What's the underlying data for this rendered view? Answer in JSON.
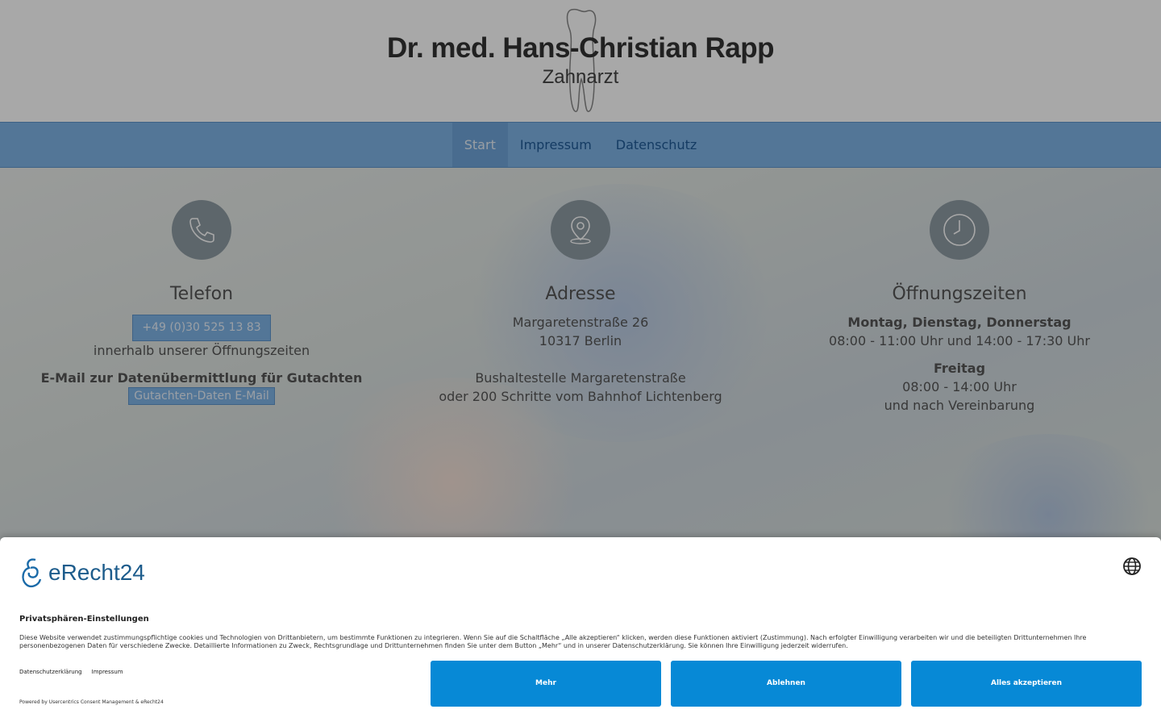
{
  "header": {
    "name": "Dr. med. Hans-Christian Rapp",
    "subtitle": "Zahnarzt"
  },
  "nav": {
    "items": [
      {
        "label": "Start",
        "active": true
      },
      {
        "label": "Impressum",
        "active": false
      },
      {
        "label": "Datenschutz",
        "active": false
      }
    ]
  },
  "contact": {
    "title": "Telefon",
    "phone": "+49 (0)30 525 13 83",
    "phone_note": "innerhalb unserer Öffnungszeiten",
    "email_heading": "E-Mail zur Datenübermittlung für Gutachten",
    "email_button": "Gutachten-Daten E-Mail",
    "icon": "phone-icon"
  },
  "address": {
    "title": "Adresse",
    "street": "Margaretenstraße 26",
    "city": "10317 Berlin",
    "transit1": "Bushaltestelle Margaretenstraße",
    "transit2": "oder 200 Schritte vom Bahnhof Lichtenberg",
    "icon": "location-pin-icon"
  },
  "hours": {
    "title": "Öffnungszeiten",
    "days1": "Montag, Dienstag, Donnerstag",
    "time1": "08:00 - 11:00 Uhr und 14:00 - 17:30 Uhr",
    "days2": "Freitag",
    "time2": "08:00 - 14:00 Uhr",
    "extra": "und nach Vereinbarung",
    "icon": "clock-icon"
  },
  "consent": {
    "brand": "eRecht24",
    "title": "Privatsphären-Einstellungen",
    "text": "Diese Website verwendet zustimmungspflichtige cookies und Technologien von Drittanbietern, um bestimmte Funktionen zu integrieren. Wenn Sie auf die Schaltfläche „Alle akzeptieren“ klicken, werden diese Funktionen aktiviert (Zustimmung). Nach erfolgter Einwilligung verarbeiten wir und die beteiligten Drittunternehmen Ihre personenbezogenen Daten für verschiedene Zwecke. Detaillierte Informationen zu Zweck, Rechtsgrundlage und Drittunternehmen finden Sie unter dem Button „Mehr“ und in unserer Datenschutzerklärung. Sie können Ihre Einwilligung jederzeit widerrufen.",
    "link_privacy": "Datenschutzerklärung",
    "link_imprint": "Impressum",
    "powered": "Powered by Usercentrics Consent Management & eRecht24",
    "btn_more": "Mehr",
    "btn_decline": "Ablehnen",
    "btn_accept": "Alles akzeptieren",
    "accent_color": "#0789d6"
  },
  "colors": {
    "nav_bg": "#7fb3e6",
    "icon_circle": "#8e9ba3"
  }
}
